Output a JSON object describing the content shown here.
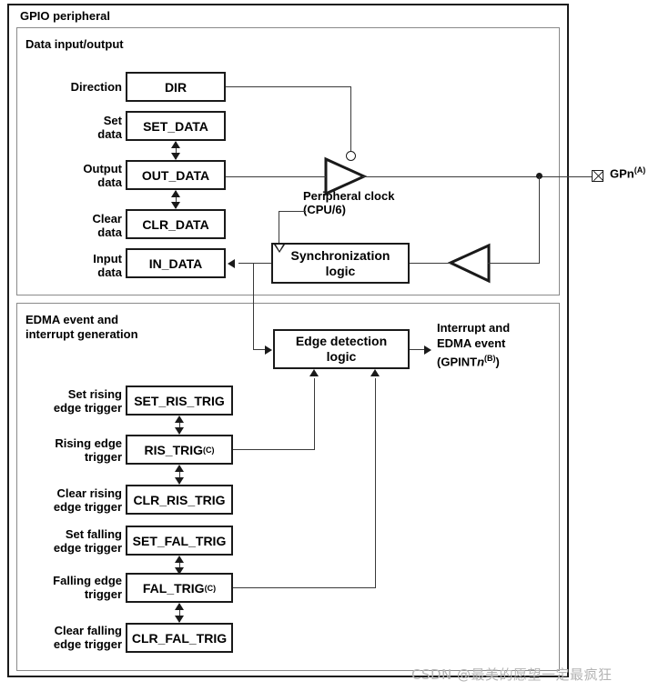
{
  "figure": {
    "outer_title": "GPIO peripheral",
    "sections": [
      {
        "id": "dataio",
        "title": "Data input/output"
      },
      {
        "id": "edma",
        "title": "EDMA event and\ninterrupt generation"
      }
    ],
    "watermark": "CSDN @最美的愿望一定最疯狂",
    "line_color": "#3a3a3a",
    "border_color": "#1a1a1a",
    "section_border_color": "#8a8a8a",
    "background": "#ffffff"
  },
  "dataio": {
    "registers": [
      {
        "label": "Direction",
        "name": "DIR"
      },
      {
        "label": "Set\ndata",
        "name": "SET_DATA"
      },
      {
        "label": "Output\ndata",
        "name": "OUT_DATA"
      },
      {
        "label": "Clear\ndata",
        "name": "CLR_DATA"
      },
      {
        "label": "Input\ndata",
        "name": "IN_DATA"
      }
    ],
    "blocks": [
      {
        "name": "Synchronization\nlogic"
      }
    ],
    "annotations": [
      {
        "text": "Peripheral clock\n(CPU/6)"
      }
    ],
    "pin": {
      "name": "GPn",
      "footnote": "(A)"
    }
  },
  "edma": {
    "registers": [
      {
        "label": "Set rising\nedge trigger",
        "name": "SET_RIS_TRIG",
        "footnote": ""
      },
      {
        "label": "Rising edge\ntrigger",
        "name": "RIS_TRIG",
        "footnote": "(C)"
      },
      {
        "label": "Clear rising\nedge trigger",
        "name": "CLR_RIS_TRIG",
        "footnote": ""
      },
      {
        "label": "Set falling\nedge trigger",
        "name": "SET_FAL_TRIG",
        "footnote": ""
      },
      {
        "label": "Falling edge\ntrigger",
        "name": "FAL_TRIG",
        "footnote": "(C)"
      },
      {
        "label": "Clear falling\nedge trigger",
        "name": "CLR_FAL_TRIG",
        "footnote": ""
      }
    ],
    "blocks": [
      {
        "name": "Edge detection\nlogic"
      }
    ],
    "output": {
      "line1": "Interrupt and",
      "line2": "EDMA event",
      "line3_prefix": "(GPINT",
      "line3_italic": "n",
      "line3_footnote": "(B)",
      "line3_suffix": ")"
    }
  }
}
